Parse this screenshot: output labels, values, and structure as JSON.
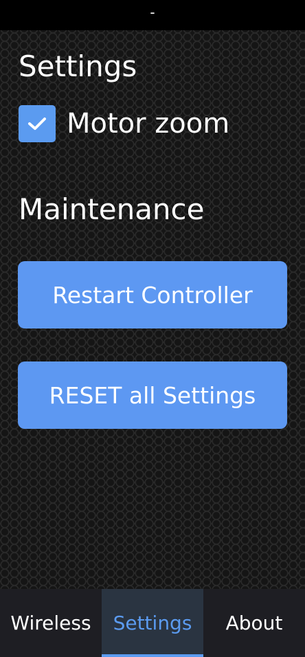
{
  "window": {
    "title": "-"
  },
  "settings": {
    "heading": "Settings",
    "motor_zoom": {
      "label": "Motor zoom",
      "checked": true
    }
  },
  "maintenance": {
    "heading": "Maintenance",
    "restart_label": "Restart Controller",
    "reset_label": "RESET all Settings"
  },
  "tabs": [
    {
      "label": "Wireless",
      "active": false
    },
    {
      "label": "Settings",
      "active": true
    },
    {
      "label": "About",
      "active": false
    }
  ],
  "colors": {
    "accent": "#5b9bf0",
    "button": "#5d98f2",
    "tab_active_bg": "#2a3441",
    "tab_bar_bg": "#1e1e23"
  }
}
